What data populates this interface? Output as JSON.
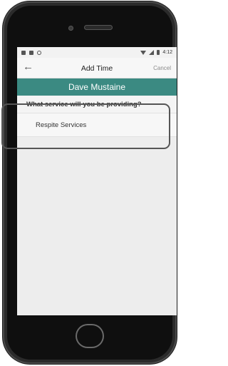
{
  "status_bar": {
    "time": "4:12"
  },
  "toolbar": {
    "back_icon": "back-arrow-icon",
    "title": "Add Time",
    "cancel_label": "Cancel"
  },
  "client": {
    "name": "Dave Mustaine"
  },
  "service": {
    "question": "What service will you be providing?",
    "options": [
      "Respite Services"
    ]
  },
  "colors": {
    "accent": "#3b8a82",
    "background": "#ededed"
  }
}
